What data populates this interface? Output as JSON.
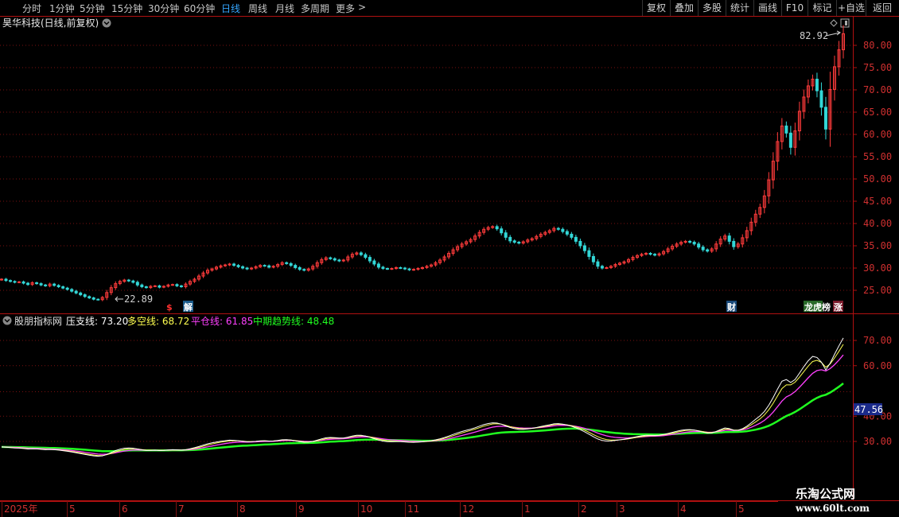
{
  "toolbar": {
    "periods": [
      "分时",
      "1分钟",
      "5分钟",
      "15分钟",
      "30分钟",
      "60分钟",
      "日线",
      "周线",
      "月线",
      "多周期",
      "更多"
    ],
    "active": "日线",
    "more_arrow": ">",
    "right_buttons": [
      "复权",
      "叠加",
      "多股",
      "统计",
      "画线",
      "F10",
      "标记",
      "+自选",
      "返回"
    ]
  },
  "chart": {
    "title": "昊华科技(日线,前复权)",
    "price_ticks": [
      "80.00",
      "75.00",
      "70.00",
      "65.00",
      "60.00",
      "55.00",
      "50.00",
      "45.00",
      "40.00",
      "35.00",
      "30.00",
      "25.00"
    ],
    "high_label": "82.92",
    "low_label": "22.89",
    "markers": [
      {
        "text": "$",
        "color": "#ff3030"
      },
      {
        "text": "解",
        "color": "#ffffff",
        "bg": "#1a5a8a"
      },
      {
        "text": "财",
        "color": "#ffffff",
        "bg": "#1a4a7a"
      },
      {
        "text": "龙虎榜",
        "color": "#ffffff",
        "bg": "#2a6a2a"
      },
      {
        "text": "涨",
        "color": "#ffffff",
        "bg": "#7a1a2a"
      }
    ],
    "candle_up_color": "#ff3b3b",
    "candle_down_color": "#32d7d7"
  },
  "indicator": {
    "name": "股朋指标网",
    "lines": [
      {
        "label": "压支线",
        "value": "73.20",
        "color": "#ffffff"
      },
      {
        "label": "多空线",
        "value": "68.72",
        "color": "#ffff50"
      },
      {
        "label": "平仓线",
        "value": "61.85",
        "color": "#ff40ff"
      },
      {
        "label": "中期趋势线",
        "value": "48.48",
        "color": "#20ff20"
      }
    ],
    "ticks": [
      "70.00",
      "60.00",
      "40.00",
      "30.00"
    ],
    "current_value": "47.56"
  },
  "time_axis": {
    "labels": [
      "2025年",
      "5",
      "6",
      "7",
      "8",
      "9",
      "10",
      "11",
      "12",
      "1",
      "2",
      "3",
      "4",
      "5"
    ]
  },
  "watermark": {
    "line1": "乐淘公式网",
    "line2": "www.60lt.com"
  },
  "chart_data": {
    "type": "candlestick",
    "close_series": [
      27.5,
      27.2,
      27.0,
      26.8,
      26.9,
      26.6,
      26.3,
      26.7,
      26.5,
      26.2,
      26.0,
      26.4,
      26.1,
      25.8,
      25.5,
      25.2,
      24.8,
      24.4,
      24.0,
      23.6,
      23.3,
      23.0,
      22.9,
      23.4,
      24.5,
      25.6,
      26.5,
      27.0,
      27.3,
      27.1,
      26.8,
      26.2,
      25.8,
      25.6,
      25.9,
      26.0,
      25.7,
      25.9,
      26.2,
      26.3,
      26.0,
      25.8,
      26.4,
      27.0,
      27.5,
      28.2,
      28.9,
      29.5,
      29.8,
      30.2,
      30.5,
      30.7,
      30.9,
      30.6,
      30.3,
      30.0,
      29.8,
      30.0,
      30.3,
      30.6,
      30.5,
      30.2,
      30.4,
      30.8,
      31.2,
      31.0,
      30.6,
      30.1,
      29.7,
      29.5,
      29.8,
      30.4,
      31.2,
      31.9,
      32.3,
      32.1,
      31.8,
      31.6,
      31.8,
      32.5,
      33.1,
      33.4,
      33.0,
      32.4,
      31.6,
      30.9,
      30.2,
      29.9,
      29.8,
      29.9,
      30.1,
      30.0,
      29.8,
      29.6,
      29.7,
      29.9,
      30.1,
      30.4,
      30.7,
      31.2,
      31.8,
      32.5,
      33.3,
      34.1,
      34.8,
      35.4,
      35.9,
      36.4,
      37.2,
      38.0,
      38.7,
      39.1,
      39.3,
      38.8,
      37.9,
      36.9,
      36.1,
      35.8,
      35.6,
      35.9,
      36.3,
      36.6,
      37.1,
      37.6,
      38.0,
      38.4,
      38.9,
      38.7,
      38.2,
      37.6,
      36.9,
      36.0,
      35.0,
      33.9,
      32.6,
      31.4,
      30.4,
      30.0,
      30.1,
      30.4,
      30.8,
      31.1,
      31.4,
      31.9,
      32.4,
      32.8,
      33.1,
      33.3,
      33.1,
      32.9,
      33.2,
      33.7,
      34.3,
      34.9,
      35.4,
      35.8,
      36.0,
      35.8,
      35.4,
      34.7,
      34.1,
      33.8,
      34.3,
      35.4,
      36.5,
      37.2,
      36.0,
      34.8,
      35.4,
      36.8,
      38.4,
      40.3,
      42.1,
      43.6,
      46.2,
      49.8,
      54.0,
      58.4,
      61.9,
      60.3,
      57.1,
      60.8,
      65.2,
      68.4,
      70.9,
      72.4,
      69.8,
      66.1,
      61.2,
      70.1,
      75.2,
      79.0,
      82.6
    ],
    "indicator_series": {
      "压支线": [
        30.7,
        30.6,
        30.5,
        30.3,
        30.1,
        30.0,
        29.8,
        29.6,
        29.4,
        29.2,
        29.0,
        28.8,
        28.6,
        28.4,
        28.3,
        28.5,
        28.9,
        29.4,
        29.8,
        30.0,
        29.9,
        29.7,
        29.6,
        29.5,
        29.6,
        29.7,
        29.8,
        30.0,
        30.6,
        31.3,
        31.9,
        32.3,
        32.4,
        32.3,
        32.2,
        31.9,
        31.6,
        31.4,
        31.2,
        31.4,
        31.8,
        32.3,
        32.8,
        33.2,
        33.6,
        33.9,
        34.0,
        33.9,
        33.6,
        33.2,
        32.9,
        32.7,
        32.8,
        33.0,
        33.1,
        33.0,
        32.9,
        32.6,
        32.3,
        32.1,
        32.0,
        32.0,
        32.3,
        32.8,
        33.4,
        34.1,
        34.8,
        35.6,
        36.2,
        36.8,
        37.1,
        36.9,
        36.5,
        36.2,
        35.9,
        35.6,
        35.4,
        35.3,
        35.4,
        35.6,
        35.9,
        36.1,
        36.3,
        36.2,
        35.9,
        35.4,
        34.6,
        33.6,
        32.7,
        32.1,
        31.9,
        32.1,
        32.5,
        32.9,
        33.3,
        33.7,
        34.1,
        34.6,
        35.3,
        36.1,
        37.0,
        37.2,
        37.0,
        36.8,
        37.2,
        38.1,
        39.7,
        42.1,
        45.6,
        49.6,
        53.9,
        57.3,
        60.5,
        64.0,
        66.8,
        68.9,
        71.0,
        73.2
      ]
    }
  }
}
